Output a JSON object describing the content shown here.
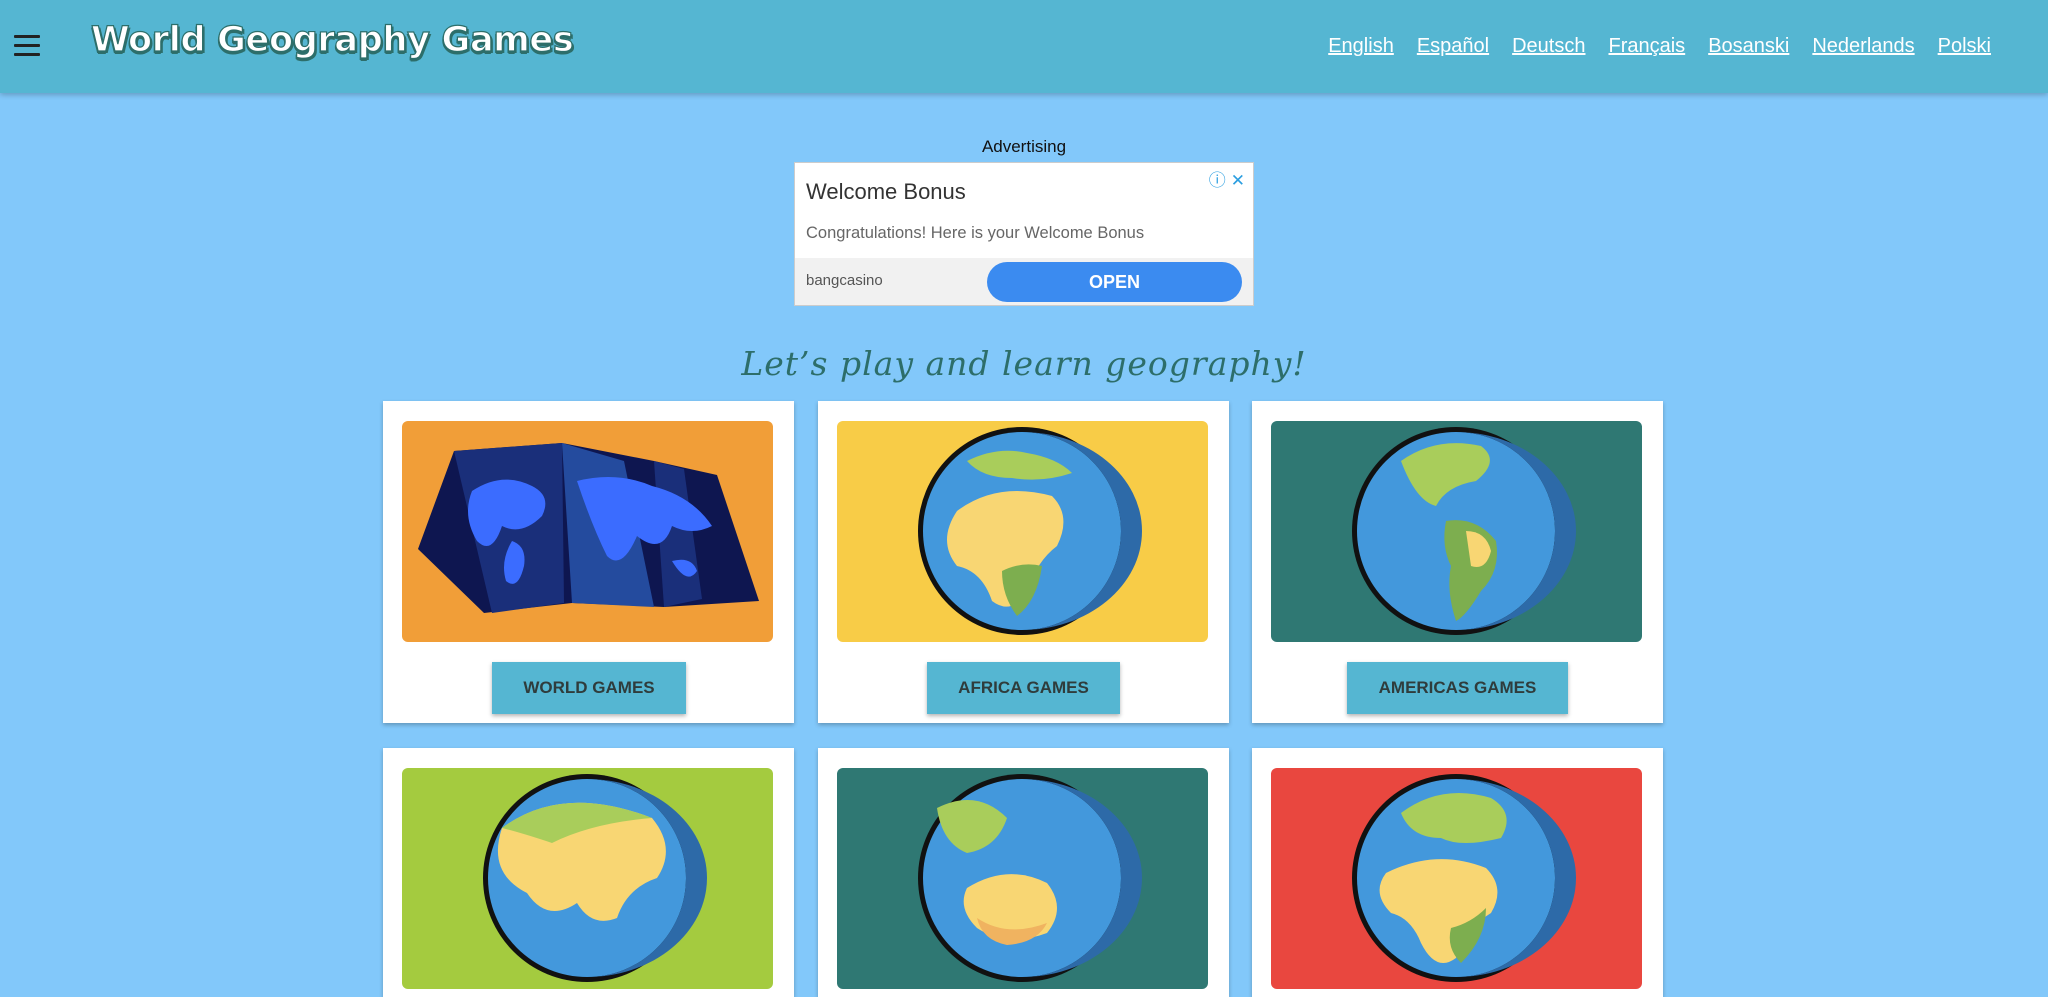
{
  "header": {
    "logo_text": "World Geography Games",
    "languages": [
      "English",
      "Español",
      "Deutsch",
      "Français",
      "Bosanski",
      "Nederlands",
      "Polski"
    ]
  },
  "ad": {
    "label": "Advertising",
    "title": "Welcome Bonus",
    "description": "Congratulations! Here is your Welcome Bonus",
    "brand": "bangcasino",
    "button": "OPEN"
  },
  "tagline": "Let’s play and learn geography!",
  "cards": [
    {
      "label": "WORLD GAMES",
      "bg": "#f19e38"
    },
    {
      "label": "AFRICA GAMES",
      "bg": "#f8cc47"
    },
    {
      "label": "AMERICAS GAMES",
      "bg": "#2f7873"
    },
    {
      "label": "",
      "bg": "#a4cb3f"
    },
    {
      "label": "",
      "bg": "#2f7873"
    },
    {
      "label": "",
      "bg": "#e9473f"
    }
  ]
}
